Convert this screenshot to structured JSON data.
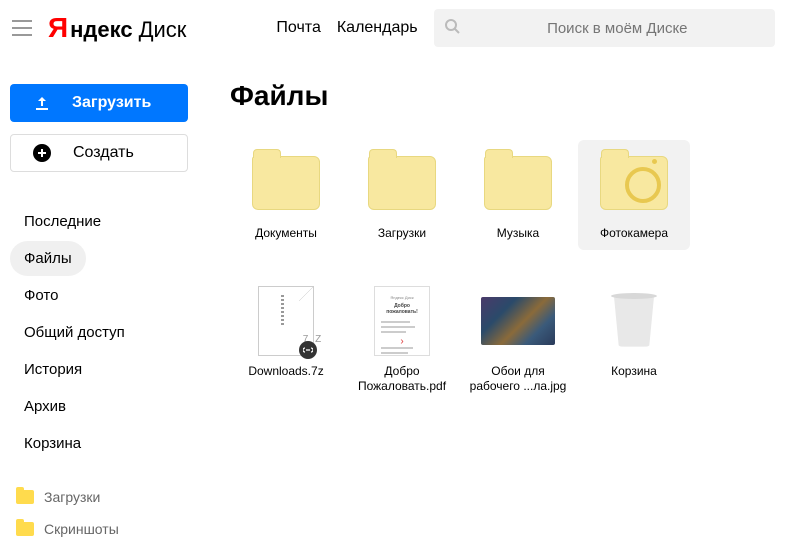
{
  "header": {
    "logo_y": "Я",
    "logo_yandex": "ндекс",
    "logo_disk": "Диск",
    "nav": [
      "Почта",
      "Календарь"
    ],
    "search_placeholder": "Поиск в моём Диске"
  },
  "sidebar": {
    "upload_label": "Загрузить",
    "create_label": "Создать",
    "nav": [
      {
        "label": "Последние",
        "active": false
      },
      {
        "label": "Файлы",
        "active": true
      },
      {
        "label": "Фото",
        "active": false
      },
      {
        "label": "Общий доступ",
        "active": false
      },
      {
        "label": "История",
        "active": false
      },
      {
        "label": "Архив",
        "active": false
      },
      {
        "label": "Корзина",
        "active": false
      }
    ],
    "folders": [
      "Загрузки",
      "Скриншоты"
    ]
  },
  "main": {
    "title": "Файлы",
    "items": [
      {
        "label": "Документы",
        "type": "folder"
      },
      {
        "label": "Загрузки",
        "type": "folder"
      },
      {
        "label": "Музыка",
        "type": "folder"
      },
      {
        "label": "Фотокамера",
        "type": "folder-camera",
        "selected": true
      },
      {
        "label": "Downloads.7z",
        "type": "7z",
        "ext_label": "7 Z"
      },
      {
        "label": "Добро Пожаловать.pdf",
        "type": "pdf"
      },
      {
        "label": "Обои для рабочего ...ла.jpg",
        "type": "image"
      },
      {
        "label": "Корзина",
        "type": "trash"
      }
    ]
  }
}
